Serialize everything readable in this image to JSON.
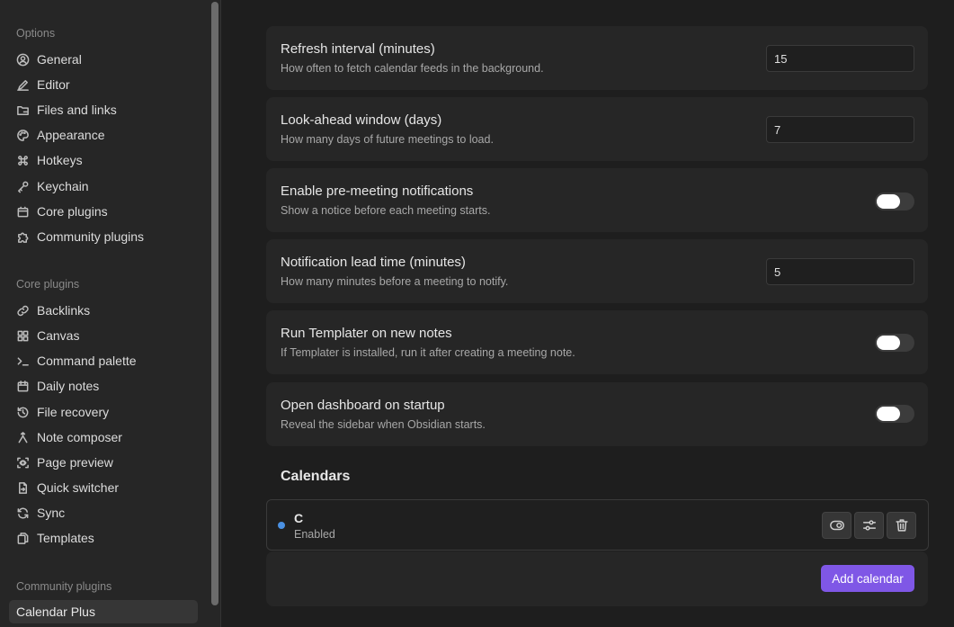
{
  "sidebar": {
    "options_heading": "Options",
    "options": [
      {
        "label": "General",
        "icon": "user-circle-icon"
      },
      {
        "label": "Editor",
        "icon": "pencil-icon"
      },
      {
        "label": "Files and links",
        "icon": "folder-icon"
      },
      {
        "label": "Appearance",
        "icon": "palette-icon"
      },
      {
        "label": "Hotkeys",
        "icon": "command-icon"
      },
      {
        "label": "Keychain",
        "icon": "key-icon"
      },
      {
        "label": "Core plugins",
        "icon": "calendar-box-icon"
      },
      {
        "label": "Community plugins",
        "icon": "puzzle-icon"
      }
    ],
    "core_heading": "Core plugins",
    "core": [
      {
        "label": "Backlinks",
        "icon": "link-icon"
      },
      {
        "label": "Canvas",
        "icon": "layout-grid-icon"
      },
      {
        "label": "Command palette",
        "icon": "terminal-icon"
      },
      {
        "label": "Daily notes",
        "icon": "calendar-icon"
      },
      {
        "label": "File recovery",
        "icon": "history-icon"
      },
      {
        "label": "Note composer",
        "icon": "merge-icon"
      },
      {
        "label": "Page preview",
        "icon": "preview-icon"
      },
      {
        "label": "Quick switcher",
        "icon": "file-arrow-icon"
      },
      {
        "label": "Sync",
        "icon": "sync-icon"
      },
      {
        "label": "Templates",
        "icon": "files-icon"
      }
    ],
    "community_heading": "Community plugins",
    "community": [
      {
        "label": "Calendar Plus",
        "active": true
      }
    ]
  },
  "settings": [
    {
      "name": "Refresh interval (minutes)",
      "desc": "How often to fetch calendar feeds in the background.",
      "type": "input",
      "value": "15"
    },
    {
      "name": "Look-ahead window (days)",
      "desc": "How many days of future meetings to load.",
      "type": "input",
      "value": "7"
    },
    {
      "name": "Enable pre-meeting notifications",
      "desc": "Show a notice before each meeting starts.",
      "type": "toggle",
      "on": false
    },
    {
      "name": "Notification lead time (minutes)",
      "desc": "How many minutes before a meeting to notify.",
      "type": "input",
      "value": "5"
    },
    {
      "name": "Run Templater on new notes",
      "desc": "If Templater is installed, run it after creating a meeting note.",
      "type": "toggle",
      "on": false
    },
    {
      "name": "Open dashboard on startup",
      "desc": "Reveal the sidebar when Obsidian starts.",
      "type": "toggle",
      "on": false
    }
  ],
  "calendars": {
    "title": "Calendars",
    "items": [
      {
        "name": "C",
        "status": "Enabled",
        "color": "#4a90e2"
      }
    ],
    "add_label": "Add calendar"
  },
  "colors": {
    "accent": "#7f57e6",
    "calendar_dot": "#4a90e2"
  }
}
